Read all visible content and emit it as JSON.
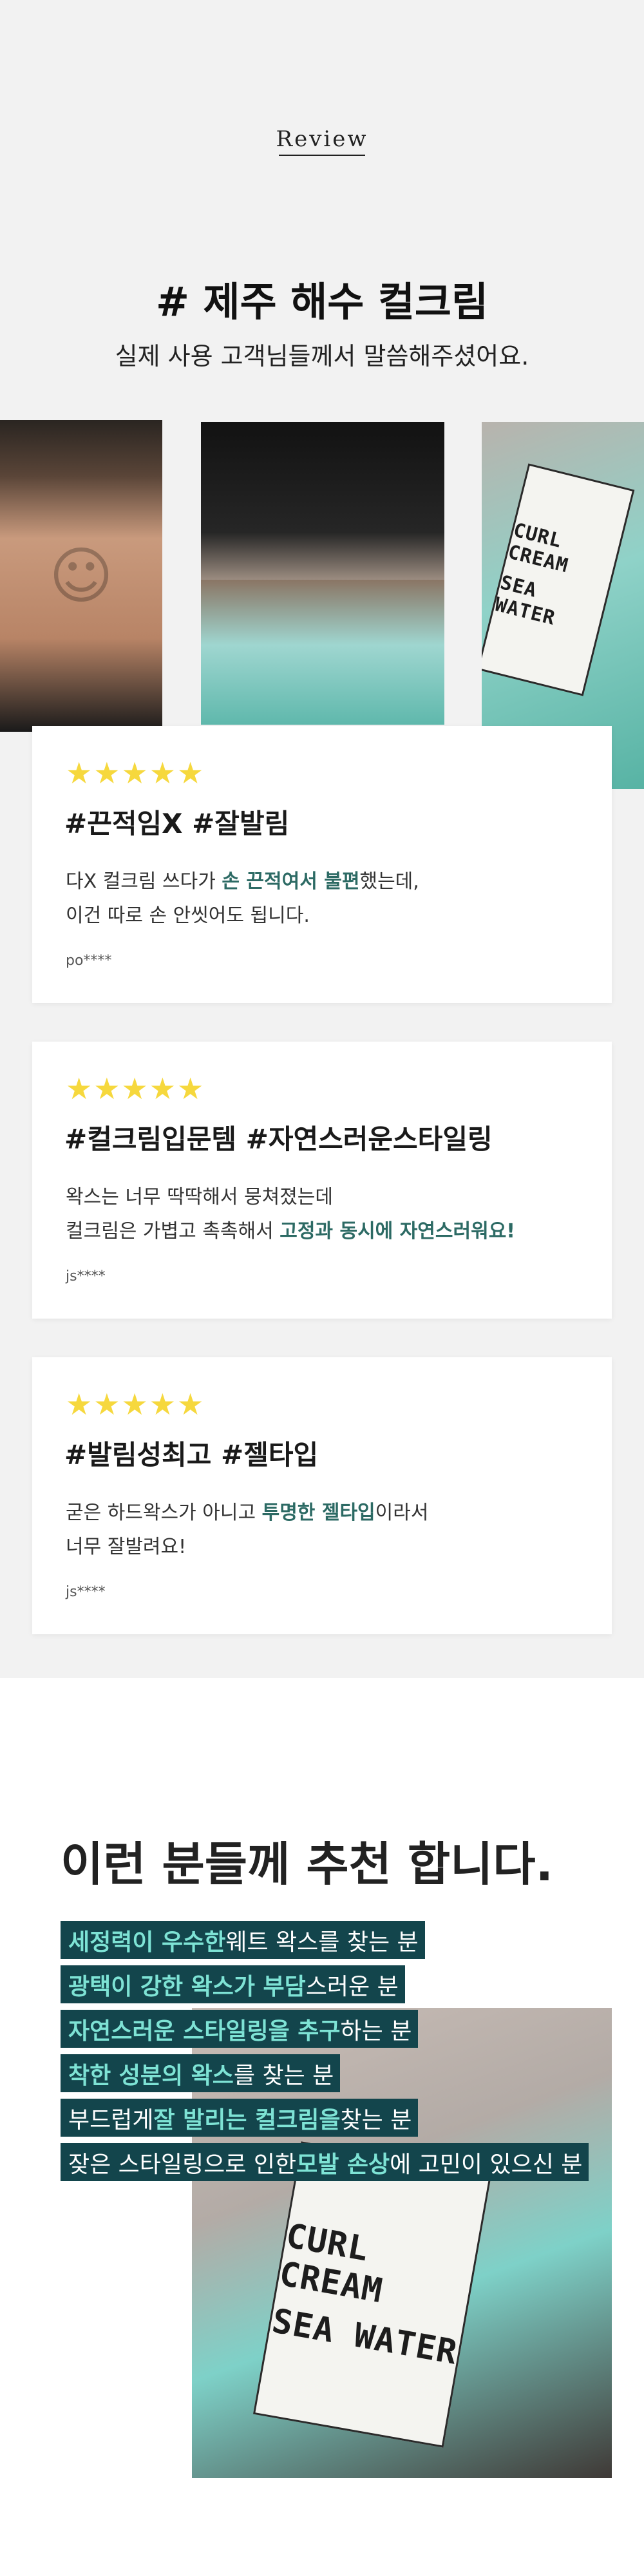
{
  "header": {
    "review_label": "Review",
    "title": "# 제주 해수 컬크림",
    "subtitle": "실제 사용 고객님들께서 말씀해주셨어요."
  },
  "photos": [
    {
      "name": "customer-face-photo",
      "icon": "person-icon"
    },
    {
      "name": "hair-and-cream-texture-photo",
      "icon": "hair-icon"
    },
    {
      "name": "curl-cream-jar-photo",
      "icon": "jar-icon",
      "label_lines": [
        "CURL CREAM",
        "SEA WATER"
      ]
    }
  ],
  "reviews": [
    {
      "stars": "★★★★★",
      "title": "#끈적임X #잘발림",
      "line1": {
        "pre": "다X 컬크림 쓰다가 ",
        "hl": "손 끈적여서 불편",
        "post": "했는데,"
      },
      "line2": {
        "pre": "이건 따로 손 안씻어도 됩니다.",
        "hl": "",
        "post": ""
      },
      "author": "po****"
    },
    {
      "stars": "★★★★★",
      "title": "#컬크림입문템 #자연스러운스타일링",
      "line1": {
        "pre": "왁스는 너무 딱딱해서 뭉쳐졌는데",
        "hl": "",
        "post": ""
      },
      "line2": {
        "pre": "컬크림은 가볍고 촉촉해서 ",
        "hl": "고정과 동시에 자연스러워요!",
        "post": ""
      },
      "author": "js****"
    },
    {
      "stars": "★★★★★",
      "title": "#발림성최고 #젤타입",
      "line1": {
        "pre": "굳은 하드왁스가 아니고 ",
        "hl": "투명한 젤타입",
        "post": "이라서"
      },
      "line2": {
        "pre": "너무 잘발려요!",
        "hl": "",
        "post": ""
      },
      "author": "js****"
    }
  ],
  "recommend": {
    "title": "이런 분들께 추천 합니다.",
    "product_label": [
      "CURL CREAM",
      "SEA WATER"
    ],
    "lines": [
      {
        "hl": "세정력이 우수한",
        "post": " 웨트 왁스를 찾는 분"
      },
      {
        "hl": "광택이 강한 왁스가 부담",
        "post": "스러운 분"
      },
      {
        "hl": "자연스러운 스타일링을 추구",
        "post": "하는 분"
      },
      {
        "hl": "착한 성분의 왁스",
        "post": "를 찾는 분"
      },
      {
        "pre": "부드럽게 ",
        "hl": "잘 발리는 컬크림을",
        "post": " 찾는 분"
      },
      {
        "pre": "잦은 스타일링으로 인한 ",
        "hl": "모발 손상",
        "post": "에 고민이 있으신 분"
      }
    ]
  },
  "colors": {
    "section_bg": "#f2f2f2",
    "star": "#f6d83d",
    "highlight_text": "#2c6a64",
    "band_bg": "#13454c",
    "band_highlight": "#7ee3d5"
  }
}
